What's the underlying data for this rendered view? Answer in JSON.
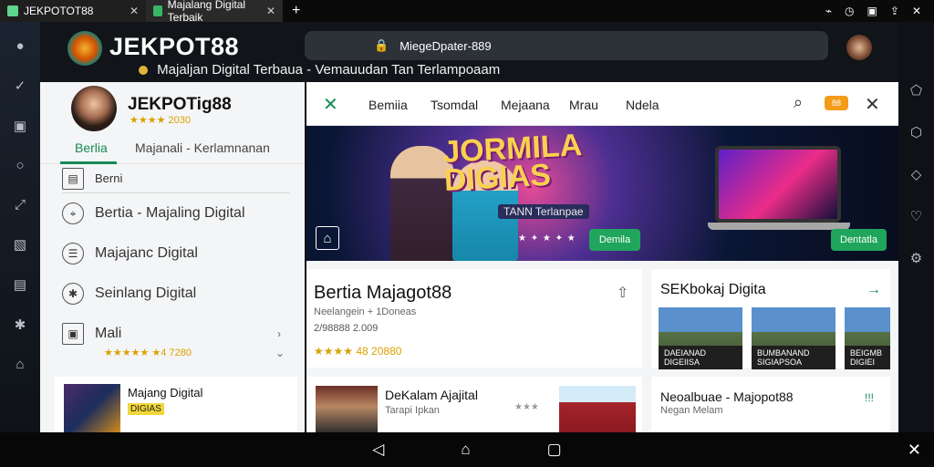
{
  "statusbar": {
    "tab1": "JEKPOTOT88",
    "tab2": "Majalang Digital Terbaik",
    "close": "✕",
    "plus": "+",
    "icons": [
      "wifi-icon",
      "clock-icon",
      "gallery-icon",
      "share-icon",
      "close-icon"
    ]
  },
  "topbar": {
    "brand": "JEKPOT88",
    "tagline": "Majaljan Digital Terbaua - Vemauudan Tan Terlampoaam",
    "url": "MiegeDpater-889",
    "lock": "🔒"
  },
  "left_panel": {
    "profile_name": "JEKPOTig88",
    "profile_rating": "★★★★ 2030",
    "tabs": [
      "Berlia",
      "Majanali - Kerlamnanan"
    ],
    "menu_items": [
      {
        "label": "Berni",
        "icon": "note-icon"
      },
      {
        "label": "Bertia - Majaling Digital",
        "icon": "compass-icon"
      },
      {
        "label": "Majajanc Digital",
        "icon": "document-icon"
      },
      {
        "label": "Seinlang Digital",
        "icon": "settings-icon"
      },
      {
        "label": "Mali",
        "icon": "gallery-icon"
      }
    ],
    "bottom_rating": "★★★★★ ★4 7280",
    "bottom_card_title": "Majang Digital",
    "bottom_card_label": "DIGIAS"
  },
  "main": {
    "nav": [
      "Bemiia",
      "Tsomdal",
      "Mejaana",
      "Mrau",
      "Ndela"
    ],
    "badge": "88",
    "hero": {
      "title_line1": "JORMILA",
      "title_line2": "DIGIAS",
      "subtitle": "TANN Terlanpae",
      "left_button": "Demila",
      "right_button": "Dentatla"
    },
    "card1": {
      "title": "Bertia Majagot88",
      "meta1": "Neelangein + 1Doneas",
      "meta2": "2/98888 2.009",
      "rating": "★★★★ 48 20880"
    },
    "card2": {
      "title": "SEKbokaj Digita",
      "tiles": [
        {
          "line1": "DAEIANAD",
          "line2": "DIGEIISA"
        },
        {
          "line1": "BUMBANAND",
          "line2": "SIGIAPSOA"
        },
        {
          "line1": "BEIGMB",
          "line2": "DIGIEI"
        }
      ]
    },
    "card3": {
      "title": "DeKalam Ajajital",
      "subtitle": "Tarapi Ipkan"
    },
    "card4": {
      "title": "Neoalbuae - Majopot88",
      "subtitle": "Negan Melam",
      "icon": "!!!"
    }
  },
  "bottom_nav": {
    "back": "◁",
    "home": "⌂",
    "recent": "▢",
    "close": "✕"
  }
}
